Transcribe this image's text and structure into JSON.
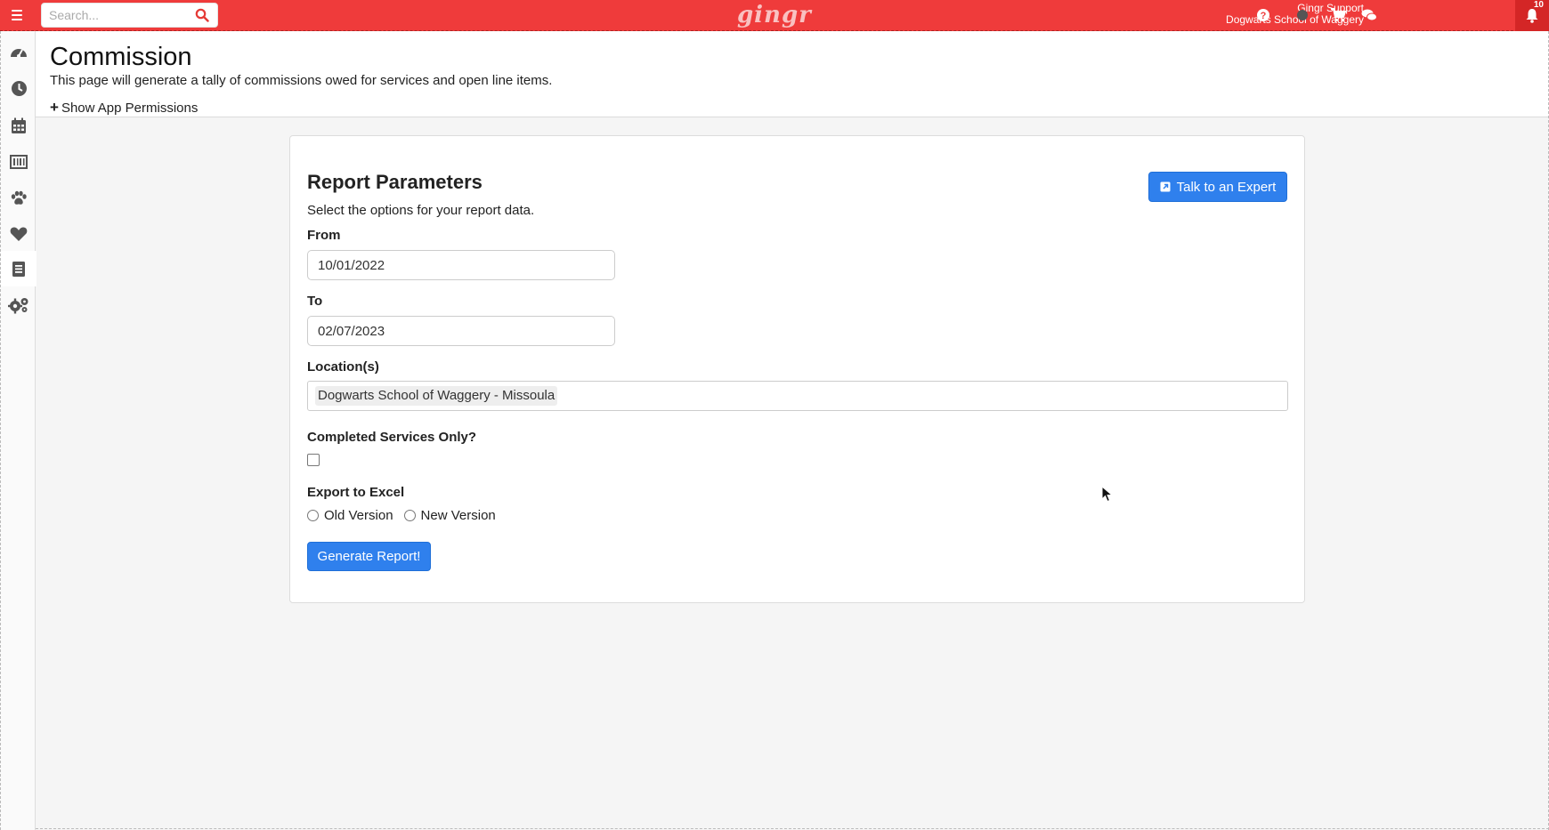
{
  "topbar": {
    "search_placeholder": "Search...",
    "logo_text": "gingr",
    "user_name": "Gingr Support",
    "business_name": "Dogwarts School of Waggery",
    "notification_count": "10",
    "icons": [
      "help-icon",
      "status-dot-icon",
      "cart-icon",
      "chat-icon",
      "bell-icon"
    ]
  },
  "sidebar": {
    "items": [
      {
        "icon": "dashboard-icon"
      },
      {
        "icon": "clock-icon"
      },
      {
        "icon": "calendar-icon"
      },
      {
        "icon": "barcode-icon"
      },
      {
        "icon": "paw-icon"
      },
      {
        "icon": "heart-icon"
      },
      {
        "icon": "book-icon",
        "active": true
      },
      {
        "icon": "settings-icon"
      }
    ]
  },
  "header": {
    "title": "Commission",
    "description": "This page will generate a tally of commissions owed for services and open line items.",
    "permissions_toggle": "Show App Permissions"
  },
  "report": {
    "title": "Report Parameters",
    "subtitle": "Select the options for your report data.",
    "expert_button": "Talk to an Expert",
    "from_label": "From",
    "from_value": "10/01/2022",
    "to_label": "To",
    "to_value": "02/07/2023",
    "locations_label": "Location(s)",
    "selected_location": "Dogwarts School of Waggery - Missoula",
    "completed_label": "Completed Services Only?",
    "completed_checked": false,
    "export_label": "Export to Excel",
    "export_options": [
      "Old Version",
      "New Version"
    ],
    "generate_button": "Generate Report!"
  },
  "colors": {
    "topbar": "#ef3b3b",
    "primary_button": "#2f80ed",
    "sidebar_icon": "#555555"
  }
}
